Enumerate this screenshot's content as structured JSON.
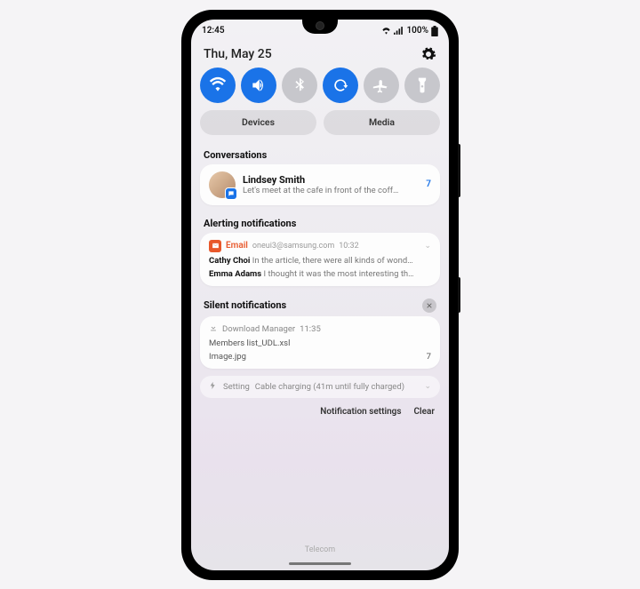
{
  "status": {
    "time": "12:45",
    "battery": "100%"
  },
  "panel": {
    "date": "Thu, May 25",
    "toggles": [
      {
        "name": "wifi",
        "on": true
      },
      {
        "name": "sound",
        "on": true
      },
      {
        "name": "bluetooth",
        "on": false
      },
      {
        "name": "rotate",
        "on": true
      },
      {
        "name": "airplane",
        "on": false
      },
      {
        "name": "flashlight",
        "on": false
      }
    ],
    "devices_label": "Devices",
    "media_label": "Media"
  },
  "sections": {
    "conversations": {
      "title": "Conversations",
      "item": {
        "name": "Lindsey Smith",
        "message": "Let's meet at the cafe in front of the coff…",
        "count": "7"
      }
    },
    "alerting": {
      "title": "Alerting notifications",
      "email": {
        "app": "Email",
        "address": "oneui3@samsung.com",
        "time": "10:32",
        "rows": [
          {
            "sender": "Cathy Choi",
            "preview": "In the article, there were all kinds of wond…"
          },
          {
            "sender": "Emma Adams",
            "preview": "I thought it was the most interesting th…"
          }
        ]
      }
    },
    "silent": {
      "title": "Silent notifications",
      "download": {
        "app": "Download Manager",
        "time": "11:35",
        "files": [
          {
            "name": "Members list_UDL.xsl",
            "count": ""
          },
          {
            "name": "Image.jpg",
            "count": "7"
          }
        ]
      },
      "setting": {
        "app": "Setting",
        "text": "Cable charging (41m until fully charged)"
      }
    }
  },
  "footer": {
    "settings_label": "Notification settings",
    "clear_label": "Clear"
  },
  "carrier": "Telecom"
}
